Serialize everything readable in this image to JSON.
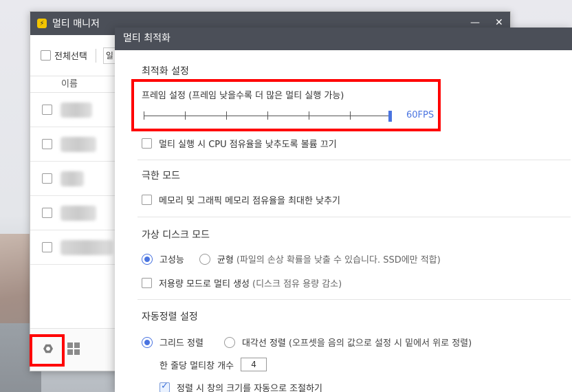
{
  "multi_manager": {
    "title": "멀티 매니저",
    "minimize_glyph": "—",
    "close_glyph": "✕",
    "toolbar": {
      "select_all_label": "전체선택",
      "partial_button_label": "일"
    },
    "column_header": "이름",
    "rows": [
      {
        "blurred_width": 46
      },
      {
        "blurred_width": 52
      },
      {
        "blurred_width": 34
      },
      {
        "blurred_width": 52
      },
      {
        "blurred_width": 76
      }
    ],
    "footer": {
      "settings_icon": "hexagon-settings-icon",
      "grid_icon": "grid-icon"
    }
  },
  "optimization": {
    "title": "멀티 최적화",
    "sections": {
      "optimize": {
        "title": "최적화 설정",
        "frame_label": "프레임 설정 (프레임 낮을수록 더 많은 멀티 실행 가능)",
        "fps_value": "60FPS",
        "fps_level": 1.0,
        "cpu_checkbox_label": "멀티 실행 시 CPU 점유율을 낮추도록 볼륨 끄기",
        "cpu_checked": false
      },
      "extreme": {
        "title": "극한 모드",
        "memory_checkbox_label": "메모리 및 그래픽 메모리 점유율을 최대한 낮추기",
        "memory_checked": false
      },
      "virtual_disk": {
        "title": "가상 디스크 모드",
        "option_high": "고성능",
        "option_balanced": "균형",
        "balanced_note": "(파일의 손상 확률을 낮출 수 있습니다. SSD에만 적합)",
        "selected": "고성능",
        "low_capacity_label": "저용량 모드로 멀티 생성",
        "low_capacity_note": "(디스크 점유 용량 감소)",
        "low_capacity_checked": false
      },
      "auto_arrange": {
        "title": "자동정렬 설정",
        "option_grid": "그리드 정렬",
        "option_diagonal": "대각선 정렬",
        "diagonal_note": "(오프셋을 음의 값으로 설정 시 밑에서 위로 정렬)",
        "selected": "그리드 정렬",
        "per_row_label": "한 줄당 멀티창 개수",
        "per_row_value": "4",
        "auto_resize_label": "정렬 시 창의 크기를 자동으로 조절하기",
        "auto_resize_checked": true
      }
    }
  },
  "colors": {
    "accent": "#4a74e0",
    "titlebar": "#4b4f58",
    "highlight": "#ff0000"
  }
}
